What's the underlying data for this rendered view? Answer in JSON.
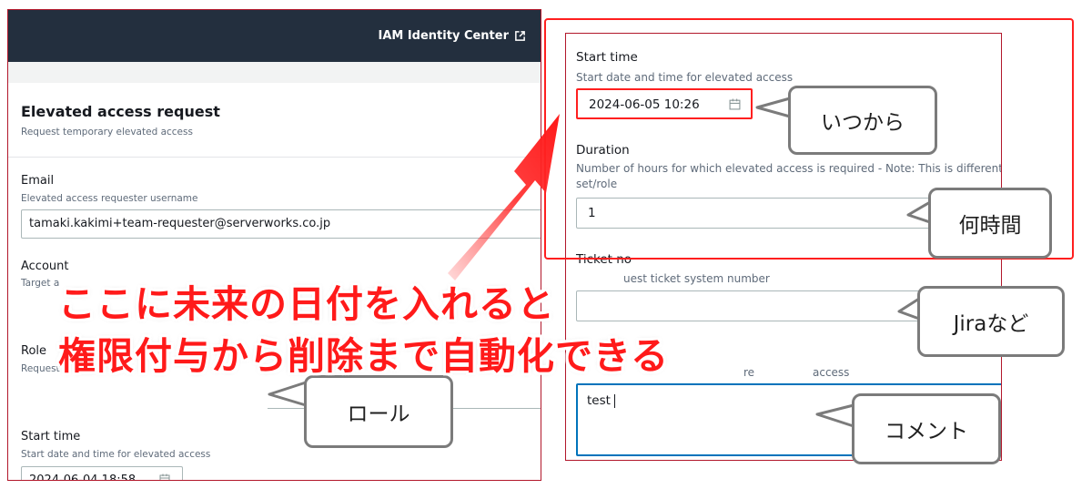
{
  "left": {
    "header_link": "IAM Identity Center",
    "card_title": "Elevated access request",
    "card_subtitle": "Request temporary elevated access",
    "email": {
      "label": "Email",
      "desc": "Elevated access requester username",
      "value": "tamaki.kakimi+team-requester@serverworks.co.jp"
    },
    "account": {
      "label": "Account",
      "desc": "Target a"
    },
    "role": {
      "label": "Role",
      "desc": "Request"
    },
    "start_time": {
      "label": "Start time",
      "desc": "Start date and time for elevated access",
      "value": "2024-06-04 18:58"
    }
  },
  "right": {
    "start_time": {
      "label": "Start time",
      "desc": "Start date and time for elevated access",
      "value": "2024-06-05 10:26"
    },
    "duration": {
      "label": "Duration",
      "desc": "Number of hours for which elevated access is required - Note: This is different f",
      "desc2": "set/role",
      "value": "1"
    },
    "ticket": {
      "label": "Ticket no",
      "desc": "uest ticket system number"
    },
    "justification": {
      "desc_tail": "re",
      "desc_end": "access",
      "value": "test"
    }
  },
  "callouts": {
    "from_when": "いつから",
    "how_long": "何時間",
    "jira": "Jiraなど",
    "role": "ロール",
    "comment": "コメント"
  },
  "overlay": {
    "line1": "ここに未来の日付を入れると",
    "line2": "権限付与から削除まで自動化できる"
  },
  "colors": {
    "header_bg": "#232f3e",
    "accent_red": "#ff1a1a",
    "focus_blue": "#0073bb"
  }
}
